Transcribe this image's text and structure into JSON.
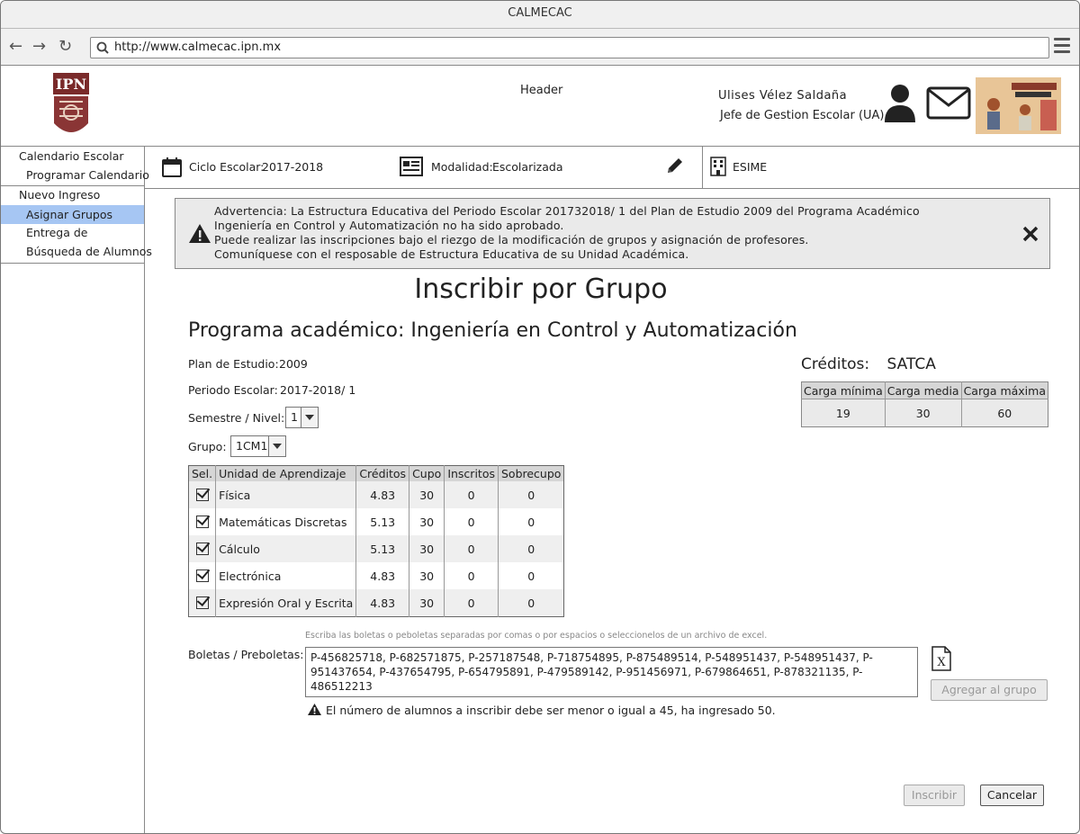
{
  "window": {
    "title": "CALMECAC"
  },
  "browser": {
    "url": "http://www.calmecac.ipn.mx"
  },
  "header": {
    "label": "Header",
    "user_name": "Ulises Vélez Saldaña",
    "user_role": "Jefe de Gestion Escolar (UA)",
    "logo_text": "IPN"
  },
  "sidebar": {
    "items": [
      {
        "label": "Calendario Escolar"
      },
      {
        "label": "Programar Calendario"
      },
      {
        "label": "Nuevo Ingreso"
      },
      {
        "label": "Asignar Grupos"
      },
      {
        "label": "Entrega de"
      },
      {
        "label": "Búsqueda de Alumnos"
      }
    ]
  },
  "infobar": {
    "ciclo_label": "Ciclo Escolar:",
    "ciclo_value": "2017-2018",
    "modalidad_label": "Modalidad:",
    "modalidad_value": "Escolarizada",
    "unidad": "ESIME"
  },
  "alert": {
    "lines": [
      "Advertencia: La Estructura Educativa del Periodo Escolar 201732018/ 1 del Plan de Estudio 2009 del Programa Académico",
      "Ingeniería en Control y Automatización no ha sido aprobado.",
      "Puede realizar las inscripciones bajo el riezgo de la modificación de grupos y asignación de profesores.",
      "Comuníquese con el resposable de Estructura Educativa de su Unidad Académica."
    ]
  },
  "page": {
    "title": "Inscribir por Grupo",
    "program_title": "Programa académico: Ingeniería en Control y Automatización",
    "plan_label": "Plan de Estudio:",
    "plan_value": "2009",
    "periodo_label": "Periodo Escolar:",
    "periodo_value": "2017-2018/ 1",
    "semestre_label": "Semestre / Nivel:",
    "semestre_value": "1",
    "grupo_label": "Grupo:",
    "grupo_value": "1CM1"
  },
  "ua_table": {
    "headers": [
      "Sel.",
      "Unidad de Aprendizaje",
      "Créditos",
      "Cupo",
      "Inscritos",
      "Sobrecupo"
    ],
    "rows": [
      {
        "name": "Física",
        "creditos": "4.83",
        "cupo": "30",
        "inscritos": "0",
        "sobrecupo": "0",
        "selected": true
      },
      {
        "name": "Matemáticas Discretas",
        "creditos": "5.13",
        "cupo": "30",
        "inscritos": "0",
        "sobrecupo": "0",
        "selected": true
      },
      {
        "name": "Cálculo",
        "creditos": "5.13",
        "cupo": "30",
        "inscritos": "0",
        "sobrecupo": "0",
        "selected": true
      },
      {
        "name": "Electrónica",
        "creditos": "4.83",
        "cupo": "30",
        "inscritos": "0",
        "sobrecupo": "0",
        "selected": true
      },
      {
        "name": "Expresión Oral y Escrita",
        "creditos": "4.83",
        "cupo": "30",
        "inscritos": "0",
        "sobrecupo": "0",
        "selected": true
      }
    ]
  },
  "credits": {
    "title": "Créditos:",
    "unit": "SATCA",
    "headers": [
      "Carga mínima",
      "Carga media",
      "Carga máxima"
    ],
    "values": [
      "19",
      "30",
      "60"
    ]
  },
  "boletas": {
    "hint": "Escriba las boletas o peboletas separadas por comas o por espacios o seleccionelos de un archivo de excel.",
    "label": "Boletas / Preboletas:",
    "value": "P-456825718, P-682571875, P-257187548, P-718754895, P-875489514, P-548951437, P-548951437, P-951437654, P-437654795, P-654795891, P-479589142, P-951456971, P-679864651, P-878321135, P-486512213",
    "error": "El número de alumnos a inscribir debe ser menor o igual a 45, ha ingresado 50.",
    "add_button": "Agregar al grupo"
  },
  "actions": {
    "inscribir": "Inscribir",
    "cancelar": "Cancelar"
  },
  "colors": {
    "selected_nav": "#a6c6f3",
    "alert_bg": "#eaeaea",
    "table_header": "#d6d6d6"
  }
}
